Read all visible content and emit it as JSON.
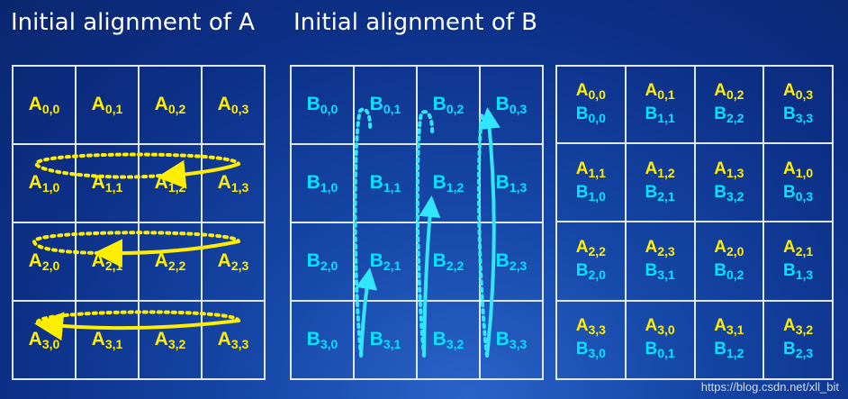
{
  "titles": {
    "a": "Initial alignment of A",
    "b": "Initial alignment of B"
  },
  "colors": {
    "a_text": "#ffee00",
    "b_text": "#00e5ff",
    "a_arrows": "#ffee00",
    "b_arrows": "#33e6ff"
  },
  "grid_a": [
    [
      "A|0,0",
      "A|0,1",
      "A|0,2",
      "A|0,3"
    ],
    [
      "A|1,0",
      "A|1,1",
      "A|1,2",
      "A|1,3"
    ],
    [
      "A|2,0",
      "A|2,1",
      "A|2,2",
      "A|2,3"
    ],
    [
      "A|3,0",
      "A|3,1",
      "A|3,2",
      "A|3,3"
    ]
  ],
  "grid_b": [
    [
      "B|0,0",
      "B|0,1",
      "B|0,2",
      "B|0,3"
    ],
    [
      "B|1,0",
      "B|1,1",
      "B|1,2",
      "B|1,3"
    ],
    [
      "B|2,0",
      "B|2,1",
      "B|2,2",
      "B|2,3"
    ],
    [
      "B|3,0",
      "B|3,1",
      "B|3,2",
      "B|3,3"
    ]
  ],
  "grid_c": [
    [
      [
        "A|0,0",
        "B|0,0"
      ],
      [
        "A|0,1",
        "B|1,1"
      ],
      [
        "A|0,2",
        "B|2,2"
      ],
      [
        "A|0,3",
        "B|3,3"
      ]
    ],
    [
      [
        "A|1,1",
        "B|1,0"
      ],
      [
        "A|1,2",
        "B|2,1"
      ],
      [
        "A|1,3",
        "B|3,2"
      ],
      [
        "A|1,0",
        "B|0,3"
      ]
    ],
    [
      [
        "A|2,2",
        "B|2,0"
      ],
      [
        "A|2,3",
        "B|3,1"
      ],
      [
        "A|2,0",
        "B|0,2"
      ],
      [
        "A|2,1",
        "B|1,3"
      ]
    ],
    [
      [
        "A|3,3",
        "B|3,0"
      ],
      [
        "A|3,0",
        "B|0,1"
      ],
      [
        "A|3,1",
        "B|1,2"
      ],
      [
        "A|3,2",
        "B|2,3"
      ]
    ]
  ],
  "watermark": "https://blog.csdn.net/xll_bit"
}
